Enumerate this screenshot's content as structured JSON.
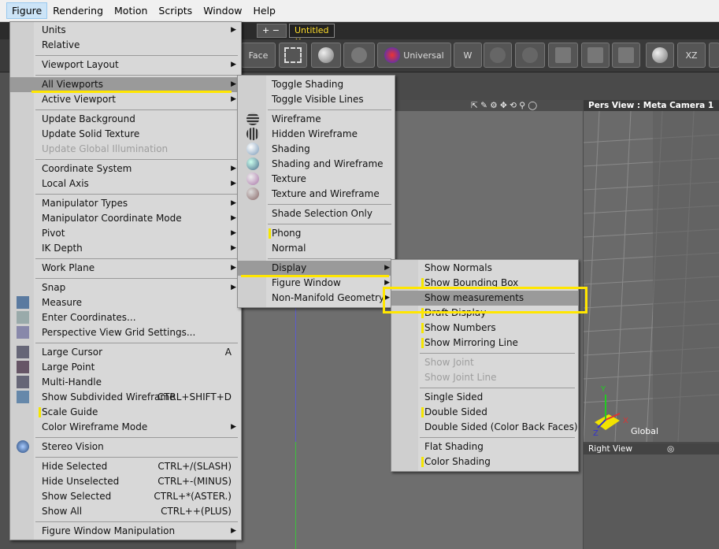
{
  "menubar": [
    "Figure",
    "Rendering",
    "Motion",
    "Scripts",
    "Window",
    "Help"
  ],
  "tabs": {
    "add_label": "+ −",
    "document": "Untitled",
    "close": "×"
  },
  "toolbar": {
    "face_label": "Face",
    "universal_label": "Universal",
    "xz_label": "XZ"
  },
  "viewports": {
    "pers_title": "Pers View : Meta Camera 1",
    "right_title": "Right View",
    "global_label": "Global",
    "axis_y": "Y",
    "axis_x": "X",
    "axis_z": "Z"
  },
  "figure_menu": [
    {
      "label": "Units",
      "arrow": true
    },
    {
      "label": "Relative"
    },
    {
      "sep": true
    },
    {
      "label": "Viewport Layout",
      "arrow": true
    },
    {
      "sep": true
    },
    {
      "label": "All Viewports",
      "arrow": true,
      "highlight": true
    },
    {
      "label": "Active Viewport",
      "arrow": true
    },
    {
      "sep": true
    },
    {
      "label": "Update Background"
    },
    {
      "label": "Update Solid Texture"
    },
    {
      "label": "Update Global Illumination",
      "disabled": true
    },
    {
      "sep": true
    },
    {
      "label": "Coordinate System",
      "arrow": true
    },
    {
      "label": "Local Axis",
      "arrow": true
    },
    {
      "sep": true
    },
    {
      "label": "Manipulator Types",
      "arrow": true
    },
    {
      "label": "Manipulator Coordinate Mode",
      "arrow": true
    },
    {
      "label": "Pivot",
      "arrow": true
    },
    {
      "label": "IK Depth",
      "arrow": true
    },
    {
      "sep": true
    },
    {
      "label": "Work Plane",
      "arrow": true
    },
    {
      "sep": true
    },
    {
      "label": "Snap",
      "arrow": true
    },
    {
      "label": "Measure",
      "icon": "measure-icon"
    },
    {
      "label": "Enter Coordinates...",
      "icon": "coordinates-icon"
    },
    {
      "label": "Perspective View Grid Settings...",
      "icon": "grid-settings-icon"
    },
    {
      "sep": true
    },
    {
      "label": "Large Cursor",
      "shortcut": "A",
      "icon": "cursor-icon"
    },
    {
      "label": "Large Point",
      "icon": "point-icon"
    },
    {
      "label": "Multi-Handle",
      "icon": "handle-icon"
    },
    {
      "label": "Show Subdivided Wireframe",
      "shortcut": "CTRL+SHIFT+D",
      "icon": "subdiv-icon"
    },
    {
      "label": "Scale Guide",
      "check": true
    },
    {
      "label": "Color Wireframe Mode",
      "arrow": true
    },
    {
      "sep": true
    },
    {
      "label": "Stereo Vision",
      "icon": "stereo-icon"
    },
    {
      "sep": true
    },
    {
      "label": "Hide Selected",
      "shortcut": "CTRL+/(SLASH)"
    },
    {
      "label": "Hide Unselected",
      "shortcut": "CTRL+-(MINUS)"
    },
    {
      "label": "Show Selected",
      "shortcut": "CTRL+*(ASTER.)"
    },
    {
      "label": "Show All",
      "shortcut": "CTRL++(PLUS)"
    },
    {
      "sep": true
    },
    {
      "label": "Figure Window Manipulation",
      "arrow": true
    }
  ],
  "viewports_menu": [
    {
      "label": "Toggle Shading"
    },
    {
      "label": "Toggle Visible Lines"
    },
    {
      "sep": true
    },
    {
      "label": "Wireframe",
      "icon": "wireframe-icon"
    },
    {
      "label": "Hidden Wireframe",
      "icon": "hidden-wireframe-icon"
    },
    {
      "label": "Shading",
      "icon": "shading-icon"
    },
    {
      "label": "Shading and Wireframe",
      "icon": "shading-wireframe-icon"
    },
    {
      "label": "Texture",
      "icon": "texture-icon"
    },
    {
      "label": "Texture and Wireframe",
      "icon": "texture-wireframe-icon"
    },
    {
      "sep": true
    },
    {
      "label": "Shade Selection Only"
    },
    {
      "sep": true
    },
    {
      "label": "Phong",
      "check": true
    },
    {
      "label": "Normal"
    },
    {
      "sep": true
    },
    {
      "label": "Display",
      "arrow": true,
      "highlight": true
    },
    {
      "label": "Figure Window",
      "arrow": true
    },
    {
      "label": "Non-Manifold Geometry",
      "arrow": true
    }
  ],
  "display_menu": [
    {
      "label": "Show Normals"
    },
    {
      "label": "Show Bounding Box",
      "check": true
    },
    {
      "label": "Show measurements",
      "highlight": true
    },
    {
      "label": "Draft Display",
      "check": true
    },
    {
      "label": "Show Numbers",
      "check": true
    },
    {
      "label": "Show Mirroring Line",
      "check": true
    },
    {
      "sep": true
    },
    {
      "label": "Show Joint",
      "disabled": true
    },
    {
      "label": "Show Joint Line",
      "disabled": true
    },
    {
      "sep": true
    },
    {
      "label": "Single Sided"
    },
    {
      "label": "Double Sided",
      "check": true
    },
    {
      "label": "Double Sided (Color Back Faces)"
    },
    {
      "sep": true
    },
    {
      "label": "Flat Shading"
    },
    {
      "label": "Color Shading",
      "check": true
    }
  ],
  "colors": {
    "menu_bg": "#d8d8d8",
    "highlight": "#9a9a9a",
    "annotation": "#ffe600",
    "check": "#f5e600"
  }
}
